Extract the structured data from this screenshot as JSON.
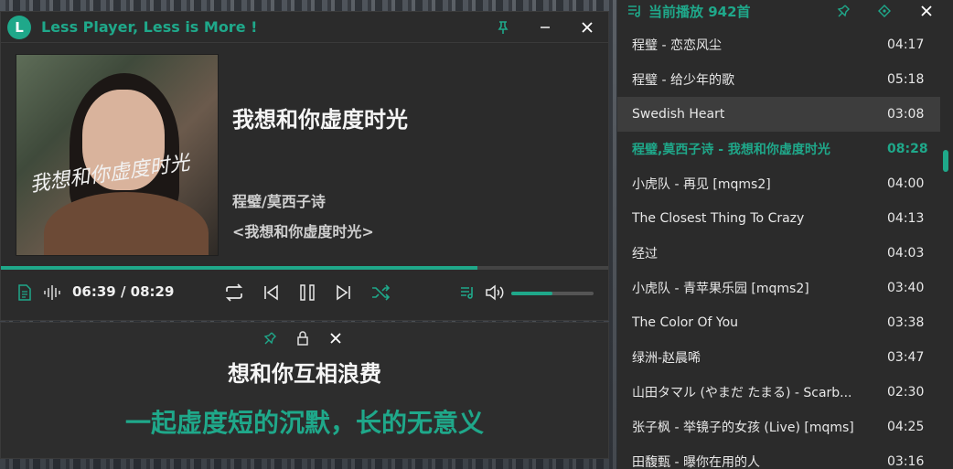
{
  "player": {
    "logo_letter": "L",
    "app_title": "Less Player, Less is More !",
    "song_title": "我想和你虚度时光",
    "artist": "程璧/莫西子诗",
    "album": "<我想和你虚度时光>",
    "cover_text": "我想和你虚度时光",
    "time": "06:39 / 08:29",
    "progress": 0.785,
    "volume": 0.5
  },
  "lyric": {
    "line1": "想和你互相浪费",
    "line2": "一起虚度短的沉默，长的无意义"
  },
  "playlist": {
    "title": "当前播放 942首",
    "items": [
      {
        "name": "程璧 - 恋恋风尘",
        "duration": "04:17"
      },
      {
        "name": "程璧 - 给少年的歌",
        "duration": "05:18"
      },
      {
        "name": "Swedish Heart",
        "duration": "03:08"
      },
      {
        "name": "程璧,莫西子诗 - 我想和你虚度时光",
        "duration": "08:28"
      },
      {
        "name": "小虎队 - 再见 [mqms2]",
        "duration": "04:00"
      },
      {
        "name": "The Closest Thing To Crazy",
        "duration": "04:13"
      },
      {
        "name": "经过",
        "duration": "04:03"
      },
      {
        "name": "小虎队 - 青苹果乐园 [mqms2]",
        "duration": "03:40"
      },
      {
        "name": "The Color Of You",
        "duration": "03:38"
      },
      {
        "name": "绿洲-赵晨唏",
        "duration": "03:47"
      },
      {
        "name": "山田タマル (やまだ たまる) - Scarb...",
        "duration": "02:30"
      },
      {
        "name": "张子枫 - 举镜子的女孩 (Live) [mqms]",
        "duration": "04:25"
      },
      {
        "name": "田馥甄 - 曝你在用的人",
        "duration": "03:16"
      }
    ]
  }
}
